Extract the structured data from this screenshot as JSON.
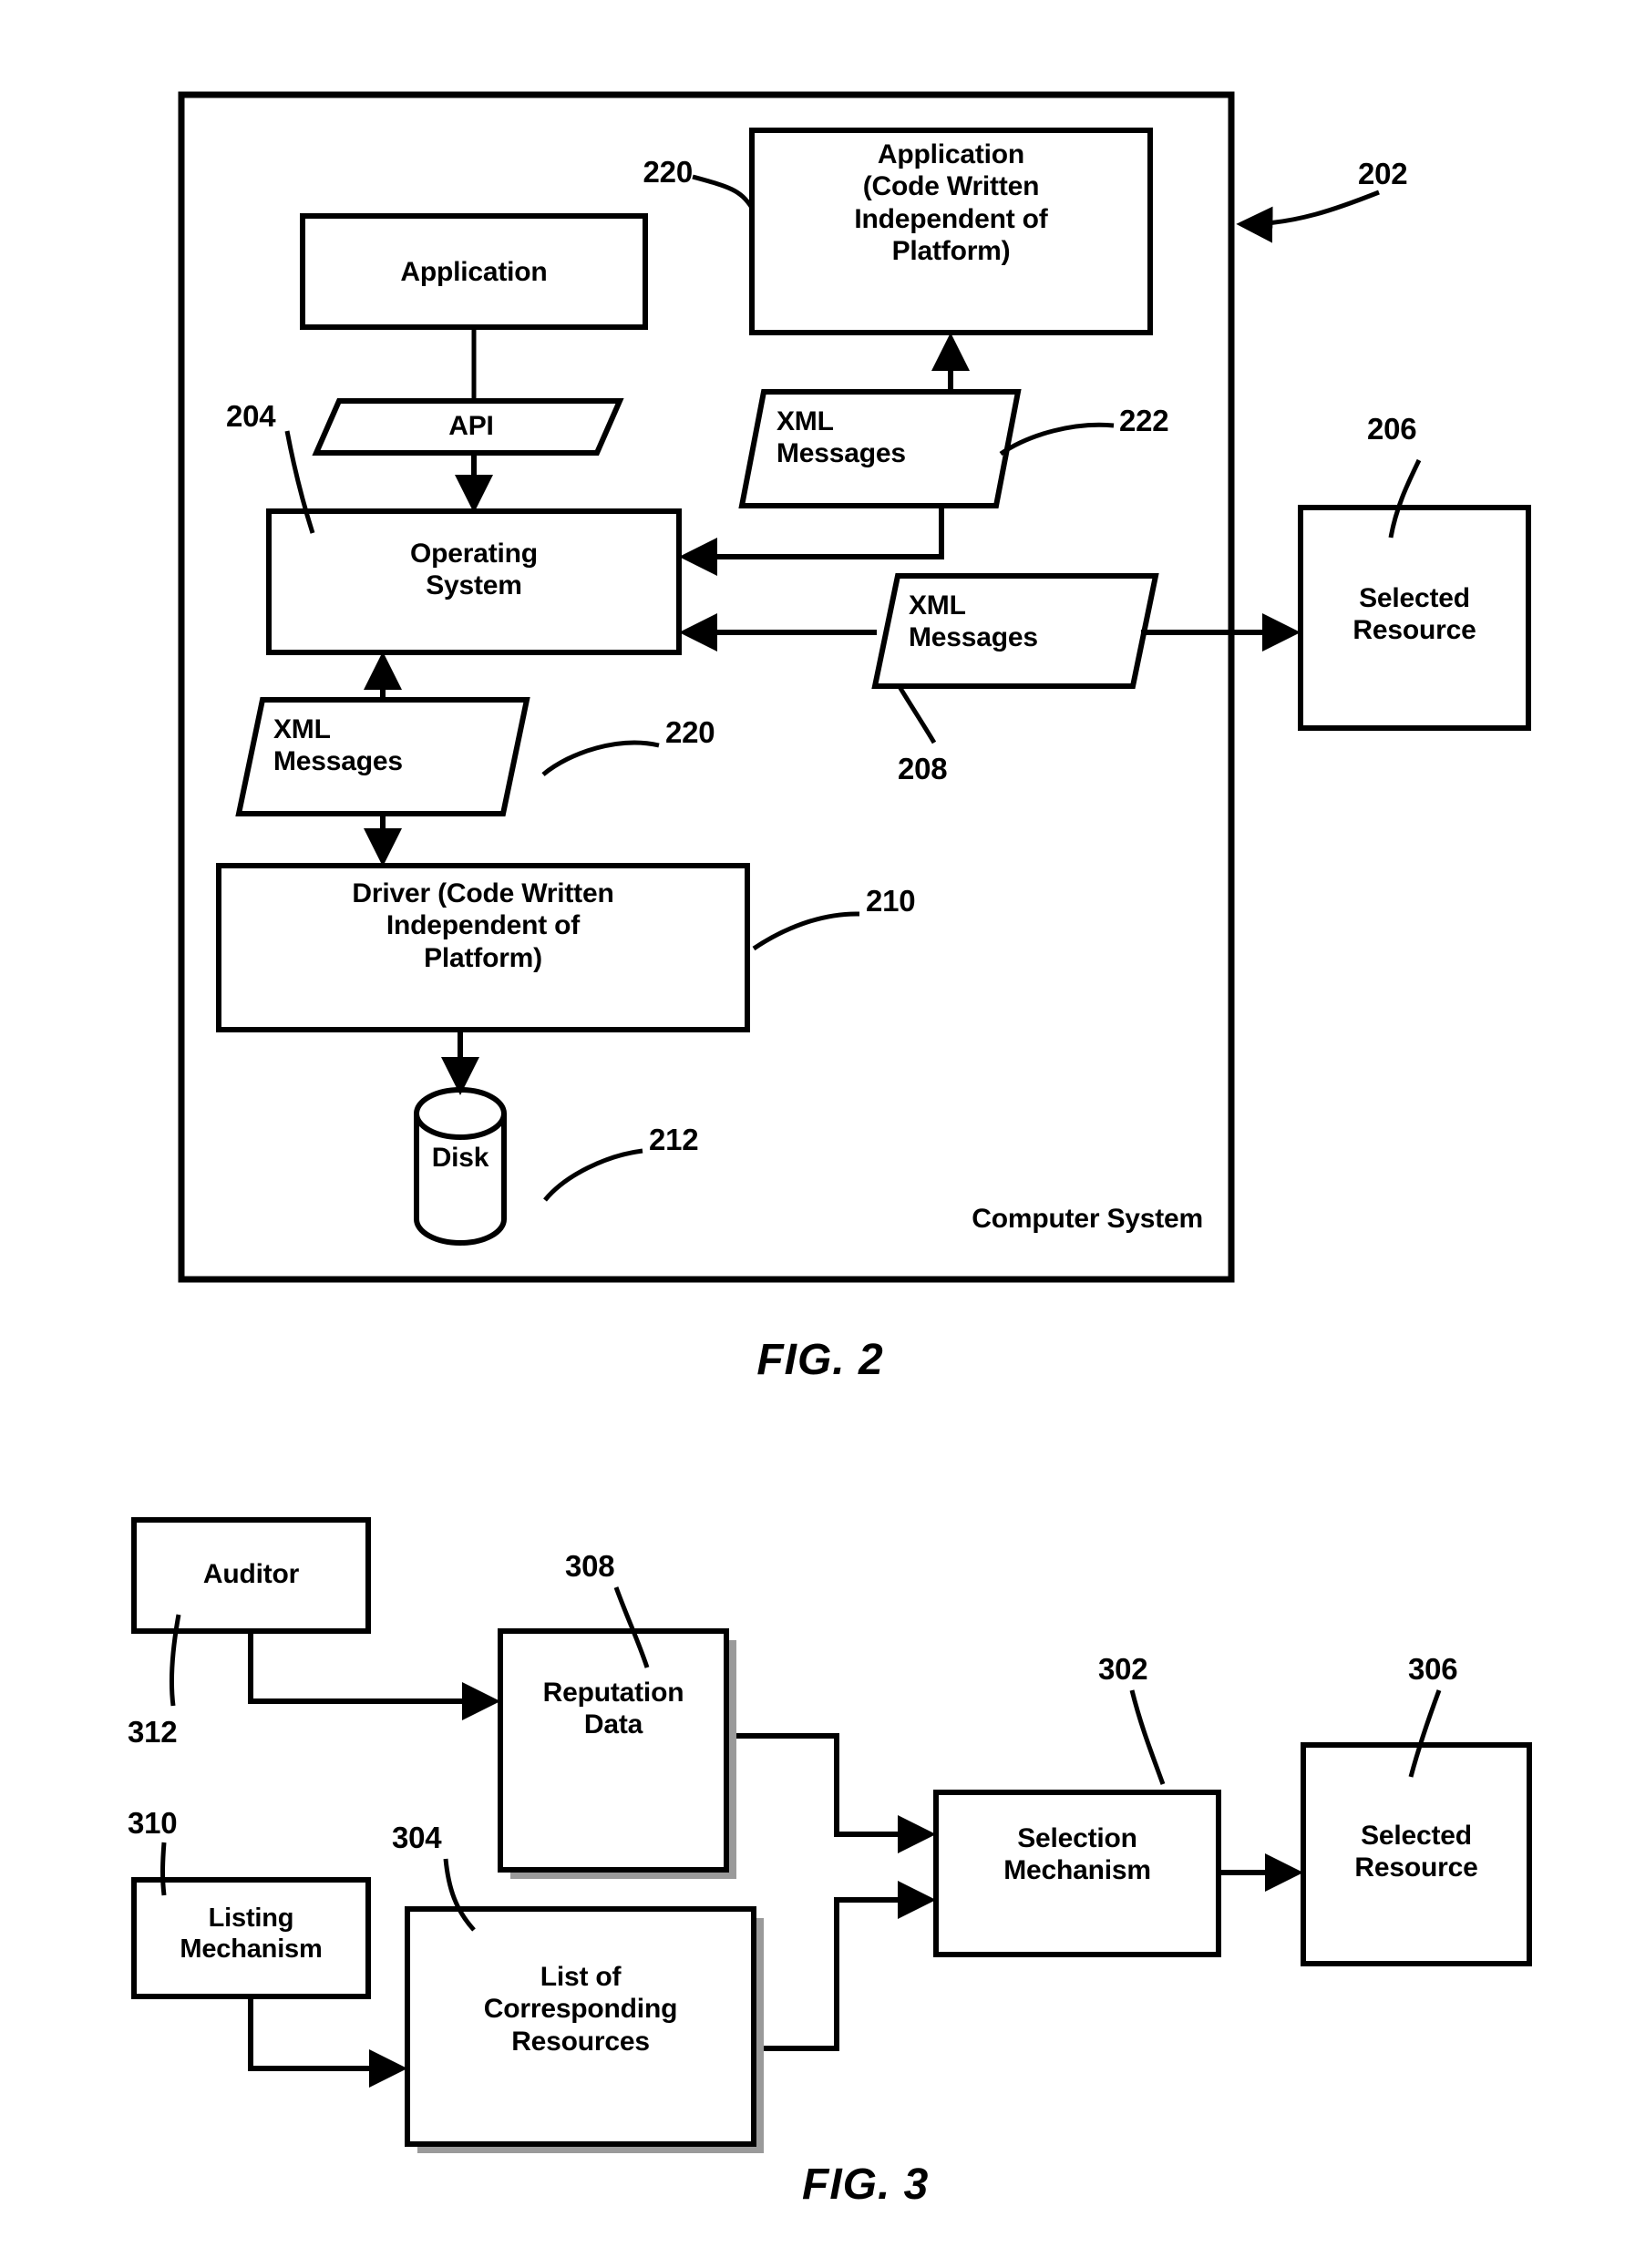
{
  "figure2": {
    "ref": "202",
    "container_label": "Computer System",
    "caption": "FIG. 2",
    "nodes": [
      {
        "id": "application",
        "label": "Application",
        "ref": null
      },
      {
        "id": "application-independent",
        "label": "Application\n(Code Written\nIndependent of\nPlatform)",
        "ref": "220"
      },
      {
        "id": "api",
        "label": "API",
        "ref": "204"
      },
      {
        "id": "operating-system",
        "label": "Operating\nSystem",
        "ref": null
      },
      {
        "id": "xml-messages-222",
        "label": "XML\nMessages",
        "ref": "222"
      },
      {
        "id": "xml-messages-208",
        "label": "XML\nMessages",
        "ref": "208"
      },
      {
        "id": "selected-resource-206",
        "label": "Selected\nResource",
        "ref": "206"
      },
      {
        "id": "xml-messages-220",
        "label": "XML\nMessages",
        "ref": "220"
      },
      {
        "id": "driver",
        "label": "Driver  (Code Written\nIndependent of\nPlatform)",
        "ref": "210"
      },
      {
        "id": "disk",
        "label": "Disk",
        "ref": "212"
      }
    ]
  },
  "figure3": {
    "caption": "FIG. 3",
    "nodes": [
      {
        "id": "auditor",
        "label": "Auditor",
        "ref": "312"
      },
      {
        "id": "reputation-data",
        "label": "Reputation\nData",
        "ref": "308"
      },
      {
        "id": "listing-mechanism",
        "label": "Listing\nMechanism",
        "ref": "310"
      },
      {
        "id": "list-of-corresponding-resources",
        "label": "List of\nCorresponding\nResources",
        "ref": "304"
      },
      {
        "id": "selection-mechanism",
        "label": "Selection\nMechanism",
        "ref": "302"
      },
      {
        "id": "selected-resource",
        "label": "Selected\nResource",
        "ref": "306"
      }
    ]
  },
  "colors": {
    "ink": "#000000",
    "paper": "#ffffff",
    "shadow": "#8a8a8a"
  }
}
